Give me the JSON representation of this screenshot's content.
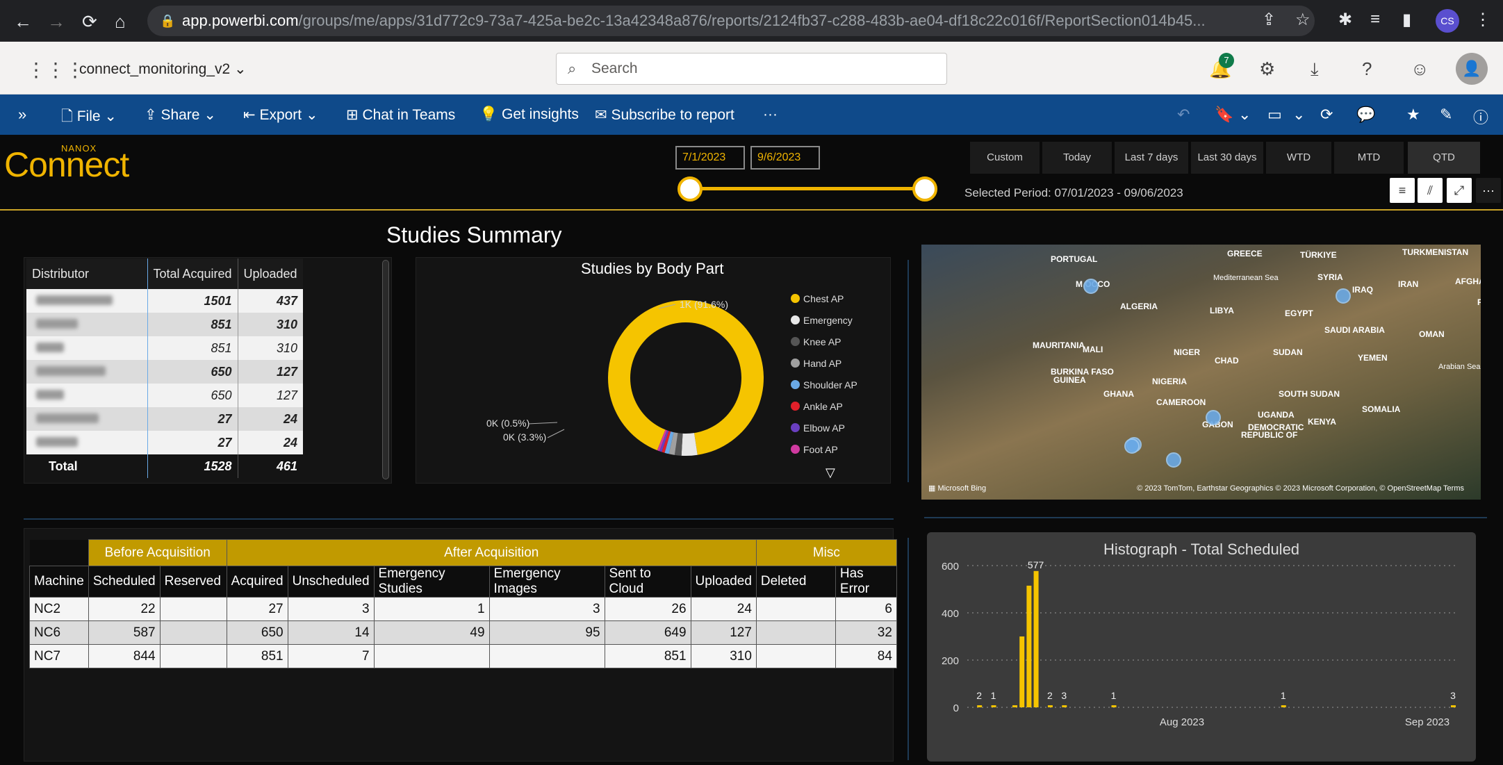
{
  "browser": {
    "url_host": "app.powerbi.com",
    "url_path": "/groups/me/apps/31d772c9-73a7-425a-be2c-13a42348a876/reports/2124fb37-c288-483b-ae04-df18c22c016f/ReportSection014b45...",
    "profile_initials": "CS"
  },
  "header": {
    "app_name": "connect_monitoring_v2",
    "search_placeholder": "Search",
    "notification_count": "7"
  },
  "toolbar": {
    "file": "File",
    "share": "Share",
    "export": "Export",
    "chat": "Chat in Teams",
    "insights": "Get insights",
    "subscribe": "Subscribe to report",
    "more": "···"
  },
  "report": {
    "logo_text": "Connect",
    "logo_brand": "NANOX",
    "date_start": "7/1/2023",
    "date_end": "9/6/2023",
    "periods": [
      "Custom",
      "Today",
      "Last 7 days",
      "Last 30 days",
      "WTD",
      "MTD",
      "QTD"
    ],
    "selected_period": "Selected Period: 07/01/2023 - 09/06/2023",
    "summary_title": "Studies Summary"
  },
  "distributor_table": {
    "headers": [
      "Distributor",
      "Total Acquired",
      "Uploaded"
    ],
    "rows": [
      {
        "acquired": "1501",
        "uploaded": "437",
        "bold": true
      },
      {
        "acquired": "851",
        "uploaded": "310",
        "bold": true
      },
      {
        "acquired": "851",
        "uploaded": "310",
        "bold": false
      },
      {
        "acquired": "650",
        "uploaded": "127",
        "bold": true
      },
      {
        "acquired": "650",
        "uploaded": "127",
        "bold": false
      },
      {
        "acquired": "27",
        "uploaded": "24",
        "bold": true
      },
      {
        "acquired": "27",
        "uploaded": "24",
        "bold": true
      }
    ],
    "total_label": "Total",
    "total_acquired": "1528",
    "total_uploaded": "461"
  },
  "donut": {
    "title": "Studies by Body Part",
    "label_main": "1K (91.6%)",
    "label_small1": "0K (0.5%)",
    "label_small2": "0K (3.3%)",
    "legend": [
      {
        "name": "Chest AP",
        "color": "#f5c400"
      },
      {
        "name": "Emergency",
        "color": "#e8e8e8"
      },
      {
        "name": "Knee AP",
        "color": "#555555"
      },
      {
        "name": "Hand AP",
        "color": "#a0a0a0"
      },
      {
        "name": "Shoulder AP",
        "color": "#6aa9e6"
      },
      {
        "name": "Ankle AP",
        "color": "#e0202a"
      },
      {
        "name": "Elbow AP",
        "color": "#6a3fc0"
      },
      {
        "name": "Foot AP",
        "color": "#d03aa0"
      }
    ],
    "shares": [
      91.6,
      3.3,
      1.4,
      1.2,
      0.9,
      0.6,
      0.5,
      0.5
    ]
  },
  "map": {
    "labels": [
      "PORTUGAL",
      "GREECE",
      "TÜRKIYE",
      "TURKMENISTAN",
      "Mediterranean Sea",
      "SYRIA",
      "IRAQ",
      "IRAN",
      "AFGHANIS",
      "M  OCCO",
      "ALGERIA",
      "LIBYA",
      "EGYPT",
      "PAK",
      "SAUDI ARABIA",
      "OMAN",
      "MAURITANIA",
      "MALI",
      "NIGER",
      "CHAD",
      "SUDAN",
      "YEMEN",
      "Arabian Sea",
      "BURKINA FASO",
      "GUINEA",
      "NIGERIA",
      "GHANA",
      "CAMEROON",
      "SOUTH SUDAN",
      "UGANDA",
      "KENYA",
      "SOMALIA",
      "GABON",
      "DEMOCRATIC",
      "REPUBLIC OF"
    ],
    "bing": "Microsoft Bing",
    "credit": "© 2023 TomTom, Earthstar Geographics  © 2023 Microsoft Corporation, © OpenStreetMap  Terms"
  },
  "acq_table": {
    "groups": [
      "Before Acquisition",
      "After Acquisition",
      "Misc"
    ],
    "headers": [
      "Machine",
      "Scheduled",
      "Reserved",
      "Acquired",
      "Unscheduled",
      "Emergency Studies",
      "Emergency Images",
      "Sent to Cloud",
      "Uploaded",
      "Deleted",
      "Has Error"
    ],
    "rows": [
      [
        "NC2",
        "22",
        "",
        "27",
        "3",
        "1",
        "3",
        "26",
        "24",
        "",
        "6"
      ],
      [
        "NC6",
        "587",
        "",
        "650",
        "14",
        "49",
        "95",
        "649",
        "127",
        "",
        "32"
      ],
      [
        "NC7",
        "844",
        "",
        "851",
        "7",
        "",
        "",
        "851",
        "310",
        "",
        "84"
      ]
    ]
  },
  "chart_data": {
    "type": "bar",
    "title": "Histograph - Total Scheduled",
    "ylim": [
      0,
      600
    ],
    "yticks": [
      0,
      200,
      400,
      600
    ],
    "xticks": [
      "Aug 2023",
      "Sep 2023"
    ],
    "data_labels": [
      "2",
      "1",
      "577",
      "2",
      "3",
      "1",
      "1",
      "3"
    ],
    "bars": [
      {
        "day": 1,
        "value": 2
      },
      {
        "day": 3,
        "value": 1
      },
      {
        "day": 6,
        "value": 1
      },
      {
        "day": 7,
        "value": 300
      },
      {
        "day": 8,
        "value": 515
      },
      {
        "day": 9,
        "value": 577
      },
      {
        "day": 11,
        "value": 2
      },
      {
        "day": 13,
        "value": 3
      },
      {
        "day": 20,
        "value": 1
      },
      {
        "day": 44,
        "value": 1
      },
      {
        "day": 68,
        "value": 3
      }
    ]
  }
}
